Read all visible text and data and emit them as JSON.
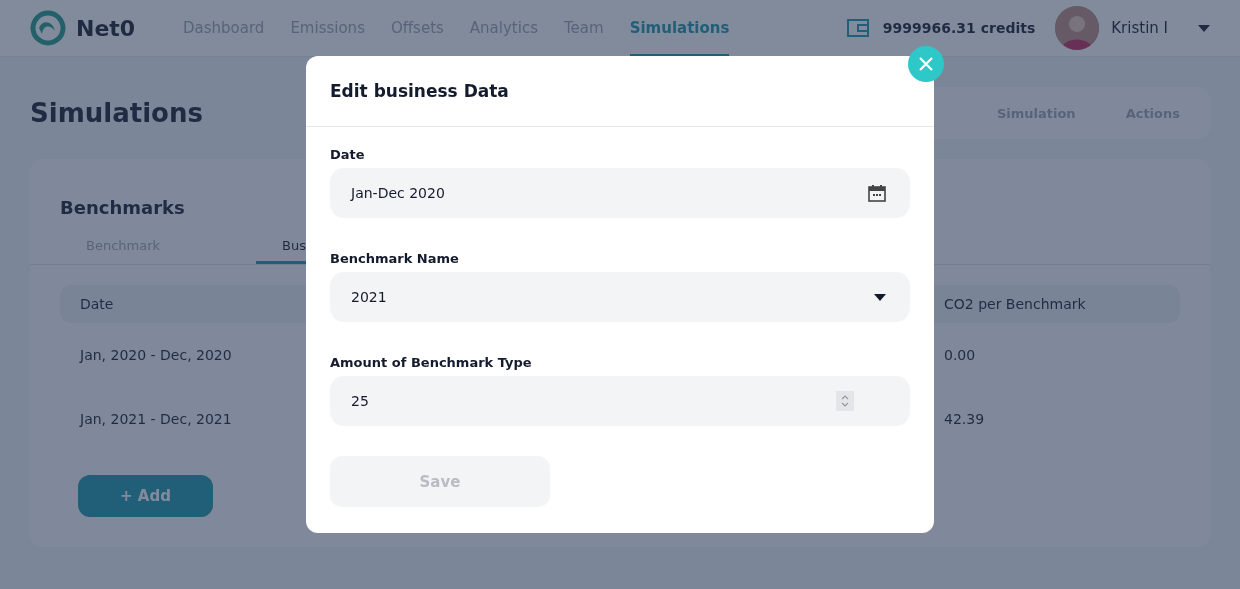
{
  "header": {
    "logo": "Net0",
    "nav": [
      {
        "label": "Dashboard",
        "selected": false
      },
      {
        "label": "Emissions",
        "selected": false
      },
      {
        "label": "Offsets",
        "selected": false
      },
      {
        "label": "Analytics",
        "selected": false
      },
      {
        "label": "Team",
        "selected": false
      },
      {
        "label": "Simulations",
        "selected": true
      }
    ],
    "credits": "9999966.31 credits",
    "user": "Kristin I"
  },
  "page": {
    "title": "Simulations",
    "panel_tabs": [
      "Simulation",
      "Actions"
    ]
  },
  "benchmarks": {
    "title": "Benchmarks",
    "tabs": [
      {
        "label": "Benchmark",
        "selected": false
      },
      {
        "label": "Bus",
        "selected": true
      }
    ],
    "table": {
      "columns": [
        "Date",
        "CO2 per Benchmark"
      ],
      "rows": [
        [
          "Jan, 2020 - Dec, 2020",
          "0.00"
        ],
        [
          "Jan, 2021 - Dec, 2021",
          "42.39"
        ]
      ]
    },
    "add_button": "+ Add"
  },
  "modal": {
    "title": "Edit business Data",
    "fields": [
      {
        "kind": "date",
        "label": "Date",
        "value": "Jan-Dec 2020"
      },
      {
        "kind": "select",
        "label": "Benchmark Name",
        "value": "2021"
      },
      {
        "kind": "number",
        "label": "Amount of Benchmark Type",
        "value": "25"
      }
    ],
    "save_button": {
      "label": "Save",
      "disabled": true
    }
  }
}
